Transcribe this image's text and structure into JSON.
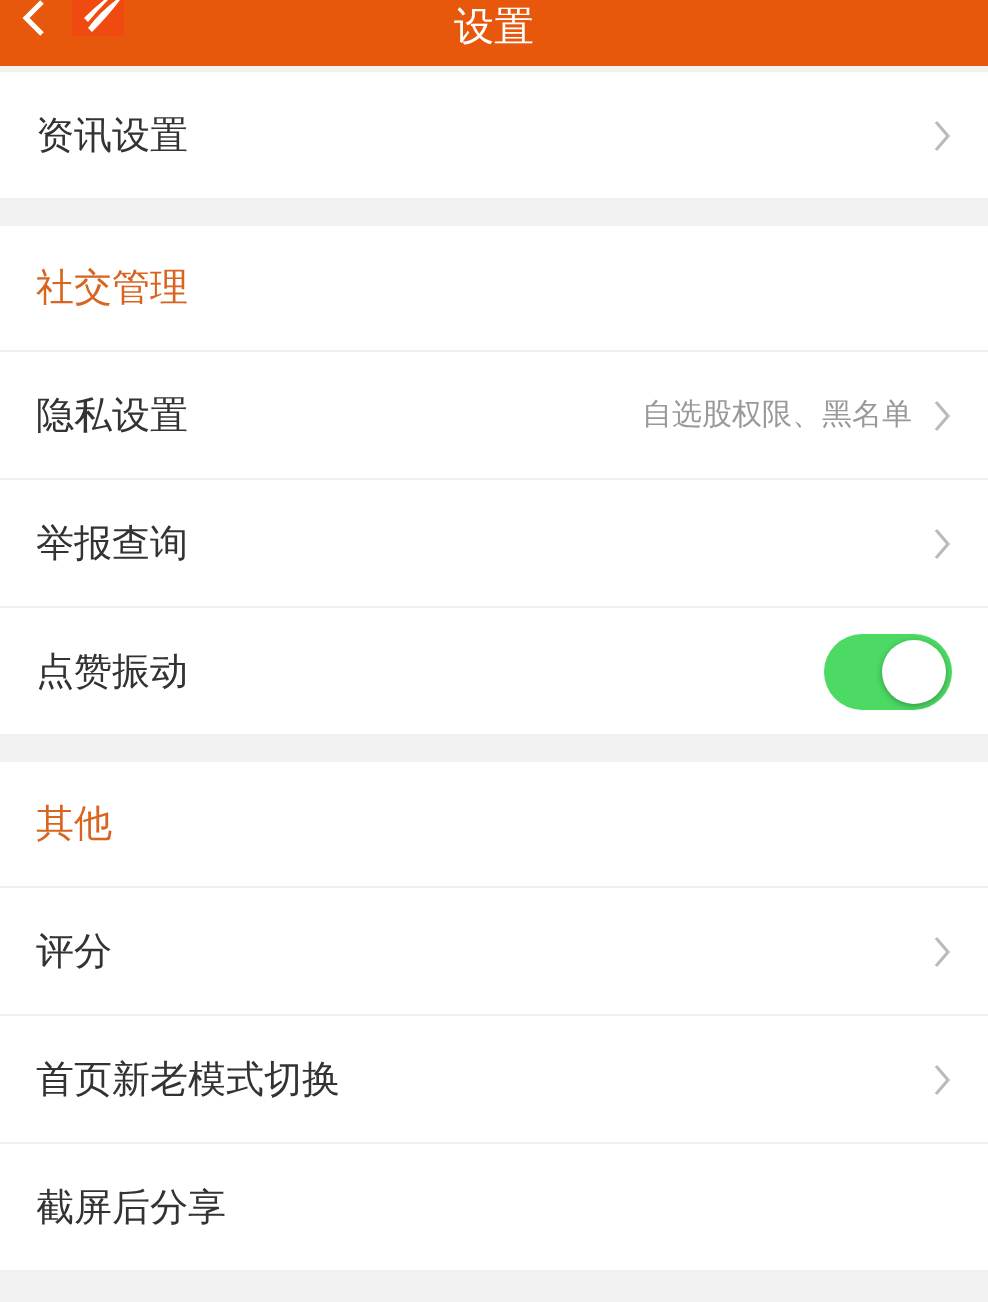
{
  "header": {
    "title": "设置"
  },
  "sections": [
    {
      "rows": [
        {
          "kind": "link",
          "label": "资讯设置"
        }
      ]
    },
    {
      "title": "社交管理",
      "rows": [
        {
          "kind": "link",
          "label": "隐私设置",
          "value": "自选股权限、黑名单"
        },
        {
          "kind": "link",
          "label": "举报查询"
        },
        {
          "kind": "toggle",
          "label": "点赞振动",
          "on": true
        }
      ]
    },
    {
      "title": "其他",
      "rows": [
        {
          "kind": "link",
          "label": "评分"
        },
        {
          "kind": "link",
          "label": "首页新老模式切换"
        },
        {
          "kind": "text",
          "label": "截屏后分享"
        }
      ]
    }
  ]
}
